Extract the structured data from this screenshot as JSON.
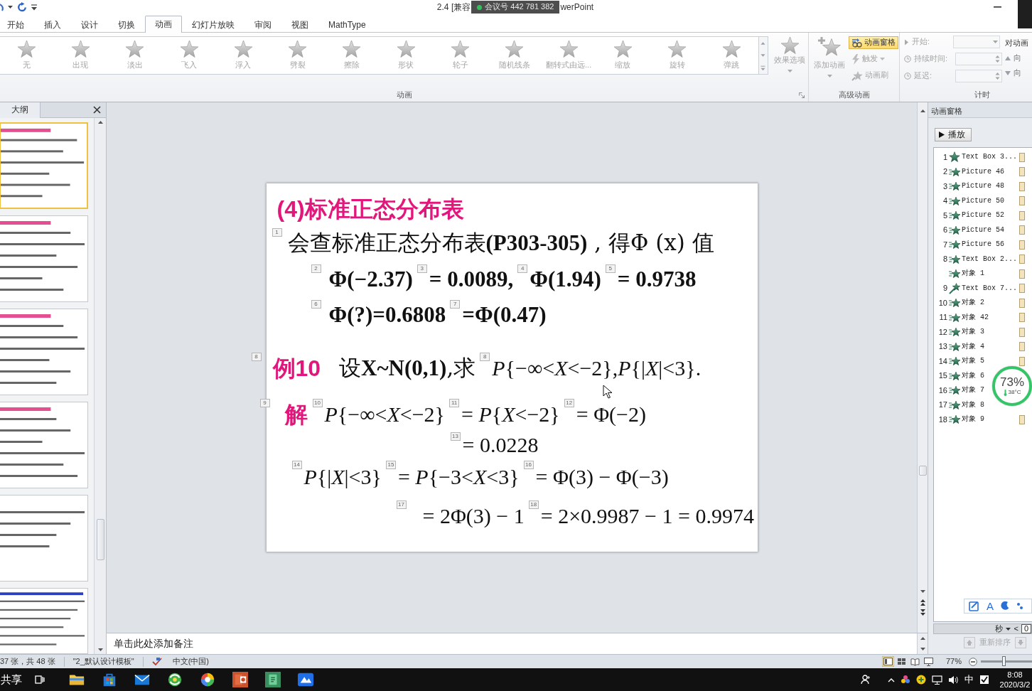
{
  "title_bar": {
    "title_left": "2.4 [兼容",
    "meeting_badge": "会议号 442 781 382",
    "title_right": "werPoint"
  },
  "ribbon_tabs": [
    {
      "label": "开始",
      "selected": false
    },
    {
      "label": "插入",
      "selected": false
    },
    {
      "label": "设计",
      "selected": false
    },
    {
      "label": "切换",
      "selected": false
    },
    {
      "label": "动画",
      "selected": true
    },
    {
      "label": "幻灯片放映",
      "selected": false
    },
    {
      "label": "审阅",
      "selected": false
    },
    {
      "label": "视图",
      "selected": false
    },
    {
      "label": "MathType",
      "selected": false
    }
  ],
  "animation_group": {
    "label": "动画",
    "effects": [
      {
        "label": "无",
        "disabled": true
      },
      {
        "label": "出现",
        "disabled": true
      },
      {
        "label": "淡出",
        "disabled": true
      },
      {
        "label": "飞入",
        "disabled": true
      },
      {
        "label": "浮入",
        "disabled": true
      },
      {
        "label": "劈裂",
        "disabled": true
      },
      {
        "label": "擦除",
        "disabled": true
      },
      {
        "label": "形状",
        "disabled": true
      },
      {
        "label": "轮子",
        "disabled": true
      },
      {
        "label": "随机线条",
        "disabled": true
      },
      {
        "label": "翻转式由远...",
        "disabled": true
      },
      {
        "label": "缩放",
        "disabled": true
      },
      {
        "label": "旋转",
        "disabled": true
      },
      {
        "label": "弹跳",
        "disabled": true
      }
    ],
    "effect_options": {
      "label": "效果选项",
      "disabled": true
    }
  },
  "advanced_group": {
    "label": "高级动画",
    "add_animation": {
      "label": "添加动画",
      "disabled": true
    },
    "animation_pane": {
      "label": "动画窗格",
      "on": true
    },
    "trigger": {
      "label": "触发",
      "disabled": true
    },
    "painter": {
      "label": "动画刷",
      "disabled": true
    }
  },
  "timing_group": {
    "label": "计时",
    "fields": [
      {
        "label": "开始:",
        "kind": "dropdown",
        "disabled": true
      },
      {
        "label": "持续时间:",
        "kind": "spin",
        "disabled": true
      },
      {
        "label": "延迟:",
        "kind": "spin",
        "disabled": true
      }
    ],
    "reorder_title": "对动画",
    "reorder_buttons": [
      {
        "label": "向",
        "kind": "up"
      },
      {
        "label": "向",
        "kind": "down"
      }
    ]
  },
  "outline_panel": {
    "tab": "大纲",
    "thumbnails": [
      {
        "selected": true
      },
      {
        "selected": false
      },
      {
        "selected": false
      },
      {
        "selected": false
      },
      {
        "selected": false
      },
      {
        "selected": false
      }
    ]
  },
  "slide": {
    "title": "(4)标准正态分布表",
    "lines": [
      {
        "items": [
          {
            "kind": "tag",
            "text": "1"
          },
          {
            "kind": "sentence",
            "text": "会查标准正态分布表**(P303-305)** , 得Φ (x) 值"
          }
        ]
      },
      {
        "items": [
          {
            "kind": "tag",
            "text": "2"
          },
          {
            "kind": "bold",
            "text": "Φ(−2.37)"
          },
          {
            "kind": "tag",
            "text": "3"
          },
          {
            "kind": "bold",
            "text": "= 0.0089,"
          },
          {
            "kind": "tag",
            "text": "4"
          },
          {
            "kind": "bold",
            "text": "Φ(1.94)"
          },
          {
            "kind": "tag",
            "text": "5"
          },
          {
            "kind": "bold",
            "text": "= 0.9738"
          }
        ]
      },
      {
        "items": [
          {
            "kind": "tag",
            "text": "6"
          },
          {
            "kind": "bold",
            "text": "Φ(?)=0.6808"
          },
          {
            "kind": "tag",
            "text": "7"
          },
          {
            "kind": "bold",
            "text": "=Φ(0.47)"
          }
        ]
      },
      {
        "tag": "8",
        "label": "例10",
        "items": [
          {
            "kind": "sentence",
            "text": "设**X~N(0,1)**,求"
          },
          {
            "kind": "tag",
            "text": "8"
          },
          {
            "kind": "math",
            "text": "*P*{−∞<*X*<−2},*P*{|*X*|<3}."
          }
        ]
      },
      {
        "tag": "9",
        "label": "解",
        "items": [
          {
            "kind": "tag",
            "text": "10"
          },
          {
            "kind": "math",
            "text": "*P*{−∞<*X*<−2}"
          },
          {
            "kind": "tag",
            "text": "11"
          },
          {
            "kind": "math",
            "text": "= *P*{*X*<−2}"
          },
          {
            "kind": "tag",
            "text": "12"
          },
          {
            "kind": "math",
            "text": "= Φ(−2)"
          }
        ]
      },
      {
        "items": [
          {
            "kind": "tag",
            "text": "13"
          },
          {
            "kind": "math",
            "text": "= 0.0228"
          }
        ]
      },
      {
        "items": [
          {
            "kind": "tag",
            "text": "14"
          },
          {
            "kind": "math",
            "text": "*P*{|*X*|<3}"
          },
          {
            "kind": "tag",
            "text": "15"
          },
          {
            "kind": "math",
            "text": "= *P*{−3<*X*<3}"
          },
          {
            "kind": "tag",
            "text": "16"
          },
          {
            "kind": "math",
            "text": "= Φ(3) − Φ(−3)"
          }
        ]
      },
      {
        "items": [
          {
            "kind": "tag",
            "text": "17"
          },
          {
            "kind": "math",
            "text": "= 2Φ(3) − 1"
          },
          {
            "kind": "tag",
            "text": "18"
          },
          {
            "kind": "math",
            "text": "= 2×0.9987 − 1 = 0.9974"
          }
        ]
      }
    ]
  },
  "notes": {
    "placeholder": "单击此处添加备注"
  },
  "animation_pane": {
    "title": "动画窗格",
    "play": "播放",
    "items": [
      {
        "number": "1",
        "name": "Text Box 3...",
        "kind": "appear"
      },
      {
        "number": "2",
        "name": "Picture 46",
        "kind": "fly"
      },
      {
        "number": "3",
        "name": "Picture 48",
        "kind": "fly"
      },
      {
        "number": "4",
        "name": "Picture 50",
        "kind": "fly"
      },
      {
        "number": "5",
        "name": "Picture 52",
        "kind": "fly"
      },
      {
        "number": "6",
        "name": "Picture 54",
        "kind": "fly"
      },
      {
        "number": "7",
        "name": "Picture 56",
        "kind": "fly"
      },
      {
        "number": "8",
        "name": "Text Box 2...",
        "kind": "fly"
      },
      {
        "name": "对象 1",
        "kind": "fly"
      },
      {
        "number": "9",
        "name": "Text Box 7...",
        "kind": "sparkle"
      },
      {
        "number": "10",
        "name": "对象 2",
        "kind": "fly"
      },
      {
        "number": "11",
        "name": "对象 42",
        "kind": "fly"
      },
      {
        "number": "12",
        "name": "对象 3",
        "kind": "fly"
      },
      {
        "number": "13",
        "name": "对象 4",
        "kind": "fly"
      },
      {
        "number": "14",
        "name": "对象 5",
        "kind": "fly"
      },
      {
        "number": "15",
        "name": "对象 6",
        "kind": "fly"
      },
      {
        "number": "16",
        "name": "对象 7",
        "kind": "fly"
      },
      {
        "number": "17",
        "name": "对象 8",
        "kind": "fly"
      },
      {
        "number": "18",
        "name": "对象 9",
        "kind": "fly"
      }
    ],
    "ime_glyph": "A",
    "timeline": {
      "unit": "秒",
      "arrow": "<",
      "value": "0"
    },
    "reorder": {
      "label": "重新排序",
      "disabled": true
    }
  },
  "system_monitor": {
    "usage": "73%",
    "temperature": "38°C"
  },
  "status_bar": {
    "slide_count": "37 张，共 48 张",
    "theme": "\"2_默认设计模板\"",
    "language": "中文(中国)",
    "views": [
      {
        "selected": true
      },
      {
        "selected": false
      },
      {
        "selected": false
      },
      {
        "selected": false
      }
    ],
    "zoom": "77%",
    "zoom_slider": {
      "level": 0.45
    }
  },
  "taskbar": {
    "share": "共享",
    "ime": "中",
    "time": "8:08",
    "date": "2020/3/2"
  }
}
